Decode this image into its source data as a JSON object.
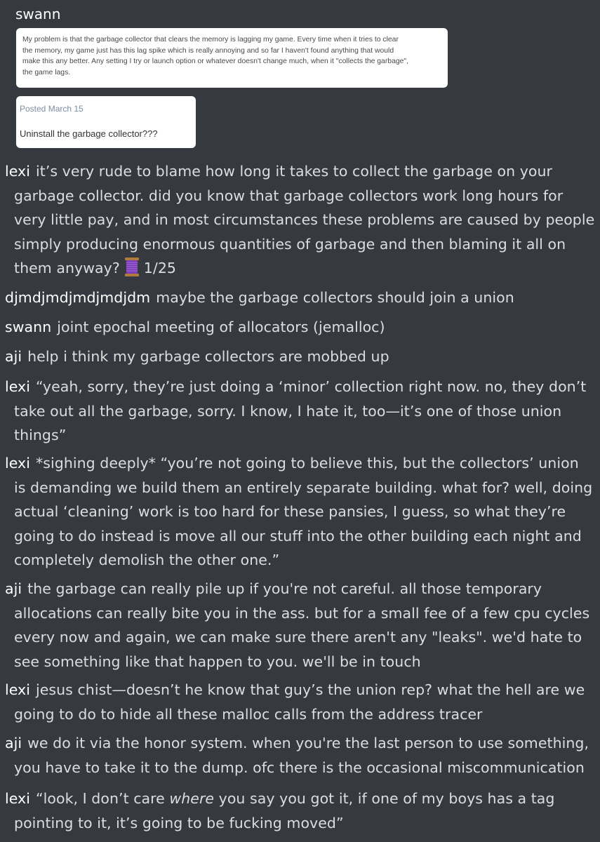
{
  "top_author": "swann",
  "card1": {
    "lines": [
      "My problem is that the garbage collector that clears the memory is lagging my game. Every time when it tries to clear",
      "the memory, my game just has this lag spike which is really annoying and so far I haven't found anything that would",
      "make this any better. Any setting I try or launch option or whatever doesn't change much, when it \"collects the garbage\",",
      "the game lags."
    ]
  },
  "card2": {
    "posted": "Posted March 15",
    "reply": "Uninstall the garbage collector???"
  },
  "messages": [
    {
      "author": "lexi",
      "lines": [
        "it’s very rude to blame how long it takes to collect the garbage on your",
        "garbage collector. did you know that garbage collectors work long hours for",
        "very little pay, and in most circumstances these problems are caused by people",
        "simply producing enormous quantities of garbage and then blaming it all on",
        "them anyway?"
      ],
      "reaction_icon": "spool-of-thread-icon",
      "reaction_count": "1/25"
    },
    {
      "author": "djmdjmdjmdjmdjdm",
      "lines": [
        "maybe the garbage collectors should join a union"
      ]
    },
    {
      "author": "swann",
      "lines": [
        "joint epochal meeting of allocators (jemalloc)"
      ]
    },
    {
      "author": "aji",
      "lines": [
        "help i think my garbage collectors are mobbed up"
      ]
    },
    {
      "author": "lexi",
      "lines": [
        "“yeah, sorry, they’re just doing a ‘minor’ collection right now. no, they don’t",
        "take out all the garbage, sorry. I know, I hate it, too—it’s one of those union",
        "things”"
      ]
    },
    {
      "author": "lexi",
      "lines": [
        "*sighing deeply* “you’re not going to believe this, but the collectors’ union",
        "is demanding we build them an entirely separate building. what for? well, doing",
        "actual ‘cleaning’ work is too hard for these pansies, I guess, so what they’re",
        "going to do instead is move all our stuff into the other building each night and",
        "completely demolish the other one.”"
      ]
    },
    {
      "author": "aji",
      "lines": [
        "the garbage can really pile up if you're not careful. all those temporary",
        "allocations can really bite you in the ass. but for a small fee of a few cpu cycles",
        "every now and again, we can make sure there aren't any \"leaks\". we'd hate to",
        "see something like that happen to you. we'll be in touch"
      ]
    },
    {
      "author": "lexi",
      "lines": [
        "jesus chist—doesn’t he know that guy’s the union rep? what the hell are we",
        "going to do to hide all these malloc calls from the address tracer"
      ]
    },
    {
      "author": "aji",
      "lines": [
        "we do it via the honor system. when you're the last person to use something,",
        "you have to take it to the dump. ofc there is the occasional miscommunication"
      ]
    },
    {
      "author": "lexi",
      "line1_before": "“look, I don’t care ",
      "line1_em": "where",
      "line1_after": " you say you got it, if one of my boys has a tag",
      "lines": [
        "pointing to it, it’s going to be fucking moved”"
      ]
    }
  ],
  "colors": {
    "background": "#36393f",
    "text": "#dcddde",
    "author": "#ffffff",
    "card": "#ffffff"
  }
}
